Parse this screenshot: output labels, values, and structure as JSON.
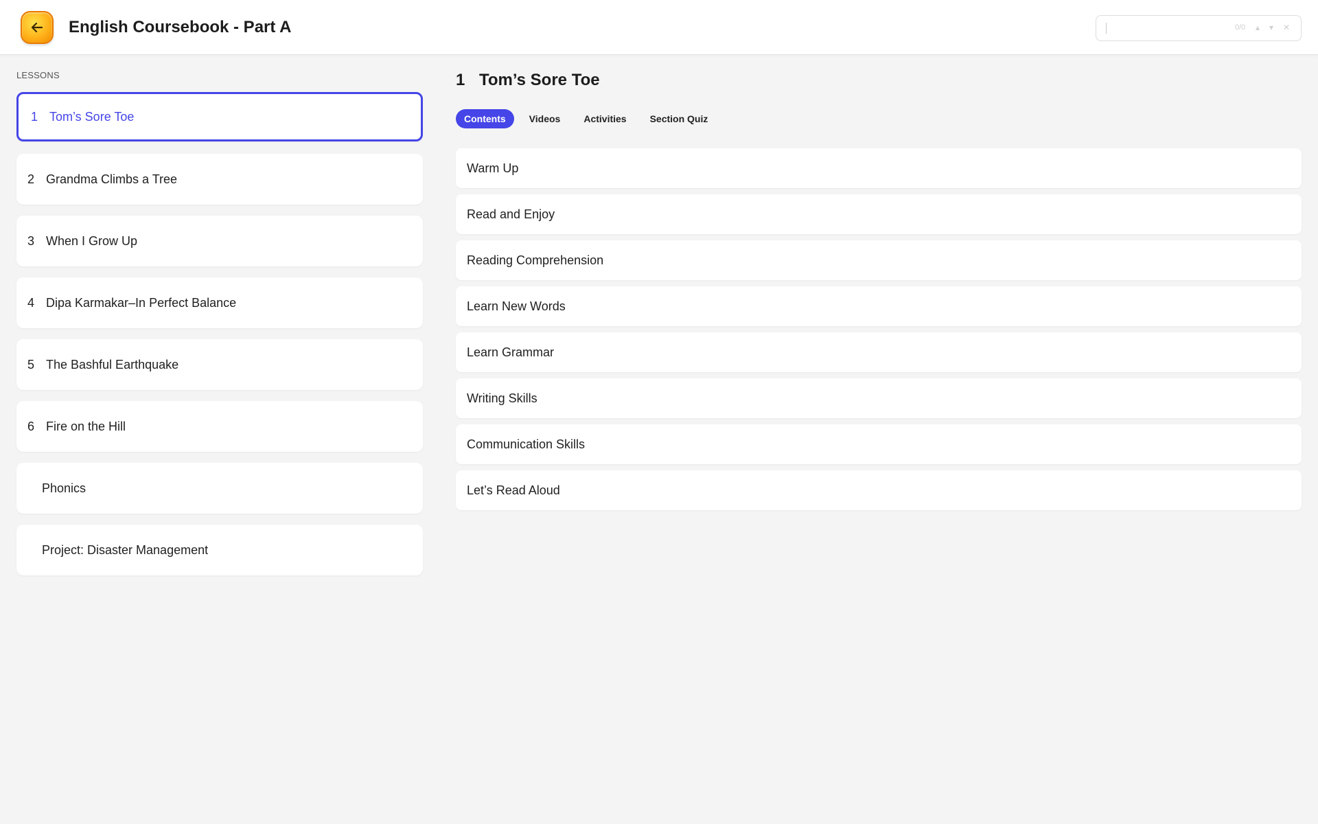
{
  "header": {
    "title": "English Coursebook - Part A",
    "back_icon": "arrow-left-icon",
    "search": {
      "value": "",
      "match_count": "0/0",
      "prev_icon": "chevron-up-icon",
      "next_icon": "chevron-down-icon",
      "close_icon": "close-icon"
    }
  },
  "sidebar": {
    "heading": "LESSONS",
    "items": [
      {
        "num": "1",
        "label": "Tom’s Sore Toe",
        "active": true
      },
      {
        "num": "2",
        "label": "Grandma Climbs a Tree"
      },
      {
        "num": "3",
        "label": "When I Grow Up"
      },
      {
        "num": "4",
        "label": "Dipa Karmakar–In Perfect Balance"
      },
      {
        "num": "5",
        "label": "The Bashful Earthquake"
      },
      {
        "num": "6",
        "label": "Fire on the Hill"
      },
      {
        "num": "",
        "label": "Phonics"
      },
      {
        "num": "",
        "label": "Project: Disaster Management"
      }
    ]
  },
  "main": {
    "lesson_num": "1",
    "lesson_title": "Tom’s Sore Toe",
    "tabs": [
      {
        "label": "Contents",
        "active": true
      },
      {
        "label": "Videos"
      },
      {
        "label": "Activities"
      },
      {
        "label": "Section Quiz"
      }
    ],
    "sections": [
      "Warm Up",
      "Read and Enjoy",
      "Reading Comprehension",
      "Learn New Words",
      "Learn Grammar",
      "Writing Skills",
      "Communication Skills",
      "Let’s Read Aloud"
    ]
  },
  "colors": {
    "accent": "#4545e8",
    "back_button": "#ffb21a",
    "background": "#f4f4f4"
  }
}
